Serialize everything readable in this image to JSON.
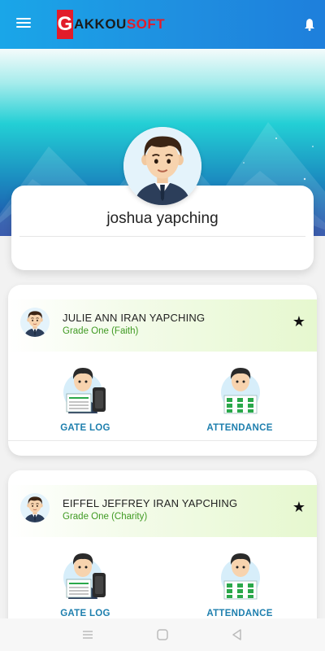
{
  "app": {
    "logo_letter": "G",
    "logo_part1": "AKKOU",
    "logo_part2": "SOFT"
  },
  "colors": {
    "appbar": "#1e8fe0",
    "brand_red": "#e21c2a",
    "grade_green": "#3f9a22",
    "action_blue": "#1e7fae"
  },
  "icons": {
    "menu": "hamburger-menu-icon",
    "notifications": "bell-icon",
    "favorite": "star-icon",
    "nav_recent": "recent-apps-icon",
    "nav_home": "home-icon",
    "nav_back": "back-icon"
  },
  "profile": {
    "name": "joshua yapching"
  },
  "students": [
    {
      "name": "JULIE ANN IRAN YAPCHING",
      "grade": "Grade One (Faith)",
      "star": "★",
      "gate_label": "GATE LOG",
      "attendance_label": "ATTENDANCE"
    },
    {
      "name": "EIFFEL JEFFREY IRAN YAPCHING",
      "grade": "Grade One (Charity)",
      "star": "★",
      "gate_label": "GATE LOG",
      "attendance_label": "ATTENDANCE"
    }
  ]
}
